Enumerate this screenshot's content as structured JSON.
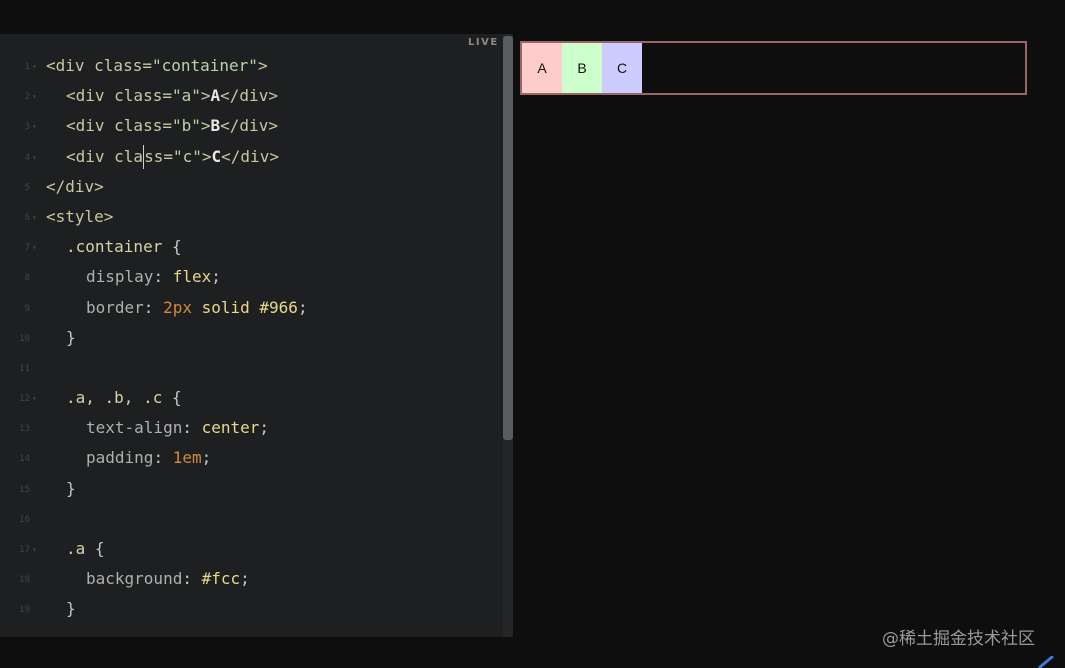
{
  "editor": {
    "live_label": "LIVE",
    "lines": [
      {
        "n": "1"
      },
      {
        "n": "2"
      },
      {
        "n": "3"
      },
      {
        "n": "4"
      },
      {
        "n": "5"
      },
      {
        "n": "6"
      },
      {
        "n": "7"
      },
      {
        "n": "8"
      },
      {
        "n": "9"
      },
      {
        "n": "10"
      },
      {
        "n": "11"
      },
      {
        "n": "12"
      },
      {
        "n": "13"
      },
      {
        "n": "14"
      },
      {
        "n": "15"
      },
      {
        "n": "16"
      },
      {
        "n": "17"
      },
      {
        "n": "18"
      },
      {
        "n": "19"
      }
    ],
    "code": {
      "l1": {
        "open": "<div",
        "attr": " class=",
        "val": "\"container\"",
        "close": ">"
      },
      "l2": {
        "open": "<div",
        "attr": " class=",
        "val": "\"a\"",
        "close": ">",
        "content": "A",
        "end": "</div>"
      },
      "l3": {
        "open": "<div",
        "attr": " class=",
        "val": "\"b\"",
        "close": ">",
        "content": "B",
        "end": "</div>"
      },
      "l4": {
        "open": "<div",
        "attr_a": " cla",
        "attr_b": "ss=",
        "val": "\"c\"",
        "close": ">",
        "content": "C",
        "end": "</div>"
      },
      "l5": {
        "end": "</div>"
      },
      "l6": {
        "open": "<style>"
      },
      "l7": {
        "selector": ".container",
        "brace": " {"
      },
      "l8": {
        "prop": "display",
        "colon": ": ",
        "value": "flex",
        "semi": ";"
      },
      "l9": {
        "prop": "border",
        "colon": ": ",
        "num": "2px",
        "value": " solid #966",
        "semi": ";"
      },
      "l10": {
        "brace": "}"
      },
      "l12": {
        "selector": ".a, .b, .c",
        "brace": " {"
      },
      "l13": {
        "prop": "text-align",
        "colon": ": ",
        "value": "center",
        "semi": ";"
      },
      "l14": {
        "prop": "padding",
        "colon": ": ",
        "num": "1em",
        "semi": ";"
      },
      "l15": {
        "brace": "}"
      },
      "l17": {
        "selector": ".a",
        "brace": " {"
      },
      "l18": {
        "prop": "background",
        "colon": ": ",
        "value": "#fcc",
        "semi": ";"
      },
      "l19": {
        "brace": "}"
      }
    }
  },
  "preview": {
    "border_color": "#966",
    "items": [
      {
        "label": "A",
        "color": "#fcc"
      },
      {
        "label": "B",
        "color": "#cfc"
      },
      {
        "label": "C",
        "color": "#ccf"
      }
    ]
  },
  "watermark": "@稀土掘金技术社区",
  "icons": {
    "pen": "pen-icon"
  }
}
